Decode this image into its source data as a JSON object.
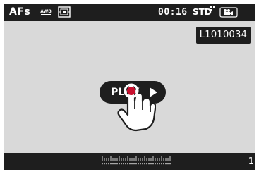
{
  "topbar": {
    "af_mode": "AFs",
    "awb_icon": "awb-icon",
    "metering_icon": "metering-icon",
    "timecode": "00:16",
    "mode": "STD",
    "video_icon": "video-camera-icon"
  },
  "file": {
    "name": "L1010034"
  },
  "play_button": {
    "label": "PLAY",
    "icon": "play-triangle-icon"
  },
  "pointer": {
    "icon": "tapping-hand-icon",
    "accent": "#c8102e"
  },
  "bottombar": {
    "scale_icon": "scale-icon",
    "counter": "1"
  },
  "colors": {
    "bar": "#1e1e1e",
    "screen": "#d9d9d9",
    "tap_dot": "#c8102e"
  }
}
